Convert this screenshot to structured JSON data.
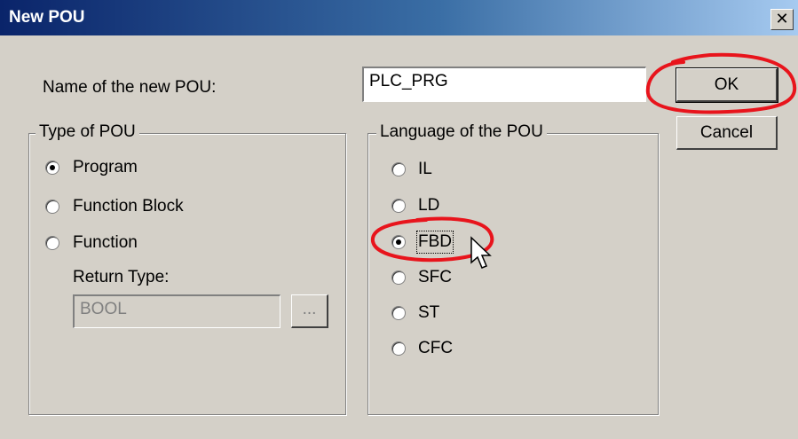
{
  "window": {
    "title": "New POU",
    "close_glyph": "✕"
  },
  "name_field": {
    "label": "Name of the new POU:",
    "value": "PLC_PRG"
  },
  "buttons": {
    "ok": "OK",
    "cancel": "Cancel"
  },
  "type_group": {
    "legend": "Type of POU",
    "options": [
      {
        "label": "Program",
        "selected": true
      },
      {
        "label": "Function Block",
        "selected": false
      },
      {
        "label": "Function",
        "selected": false
      }
    ],
    "return_type": {
      "label": "Return Type:",
      "value": "BOOL",
      "browse_label": "..."
    }
  },
  "language_group": {
    "legend": "Language of the POU",
    "options": [
      {
        "label": "IL",
        "selected": false
      },
      {
        "label": "LD",
        "selected": false
      },
      {
        "label": "FBD",
        "selected": true
      },
      {
        "label": "SFC",
        "selected": false
      },
      {
        "label": "ST",
        "selected": false
      },
      {
        "label": "CFC",
        "selected": false
      }
    ]
  },
  "colors": {
    "annotation": "#e8141c",
    "title_bar_start": "#0a246a",
    "dialog_bg": "#d4d0c8"
  }
}
